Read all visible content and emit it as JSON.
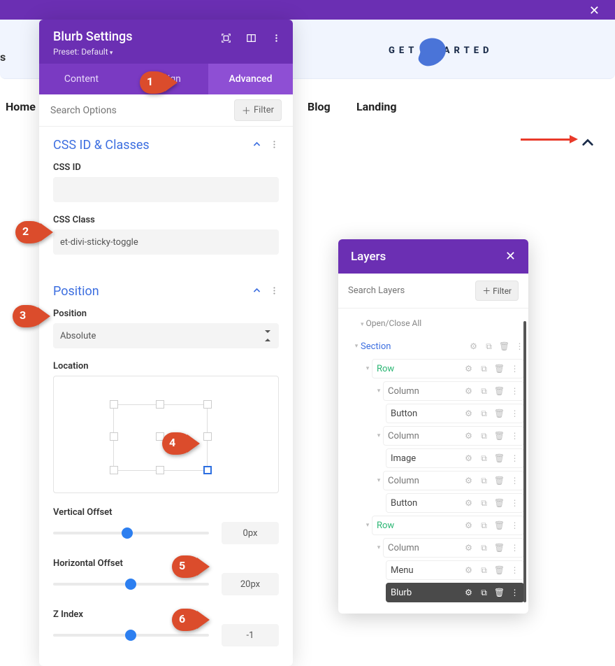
{
  "topnav": {
    "home": "Home",
    "blog": "Blog",
    "landing": "Landing",
    "cta": "GET STARTED",
    "side": "s"
  },
  "panel": {
    "title": "Blurb Settings",
    "preset": "Preset: Default",
    "tabs": [
      "Content",
      "Design",
      "Advanced"
    ],
    "search_placeholder": "Search Options",
    "filter": "Filter",
    "sections": {
      "css": {
        "title": "CSS ID & Classes",
        "id_label": "CSS ID",
        "id_value": "",
        "class_label": "CSS Class",
        "class_value": "et-divi-sticky-toggle"
      },
      "position": {
        "title": "Position",
        "position_label": "Position",
        "position_value": "Absolute",
        "location_label": "Location",
        "voff_label": "Vertical Offset",
        "voff_value": "0px",
        "hoff_label": "Horizontal Offset",
        "hoff_value": "20px",
        "z_label": "Z Index",
        "z_value": "-1"
      }
    }
  },
  "layers": {
    "title": "Layers",
    "search_placeholder": "Search Layers",
    "filter": "Filter",
    "open_close": "Open/Close All",
    "tree": {
      "section": "Section",
      "rows": [
        {
          "label": "Row",
          "cols": [
            {
              "label": "Column",
              "mod": "Button"
            },
            {
              "label": "Column",
              "mod": "Image"
            },
            {
              "label": "Column",
              "mod": "Button"
            }
          ]
        },
        {
          "label": "Row",
          "cols": [
            {
              "label": "Column",
              "mod": "Menu"
            }
          ],
          "extra": "Blurb"
        }
      ]
    }
  },
  "callouts": {
    "1": "1",
    "2": "2",
    "3": "3",
    "4": "4",
    "5": "5",
    "6": "6"
  }
}
